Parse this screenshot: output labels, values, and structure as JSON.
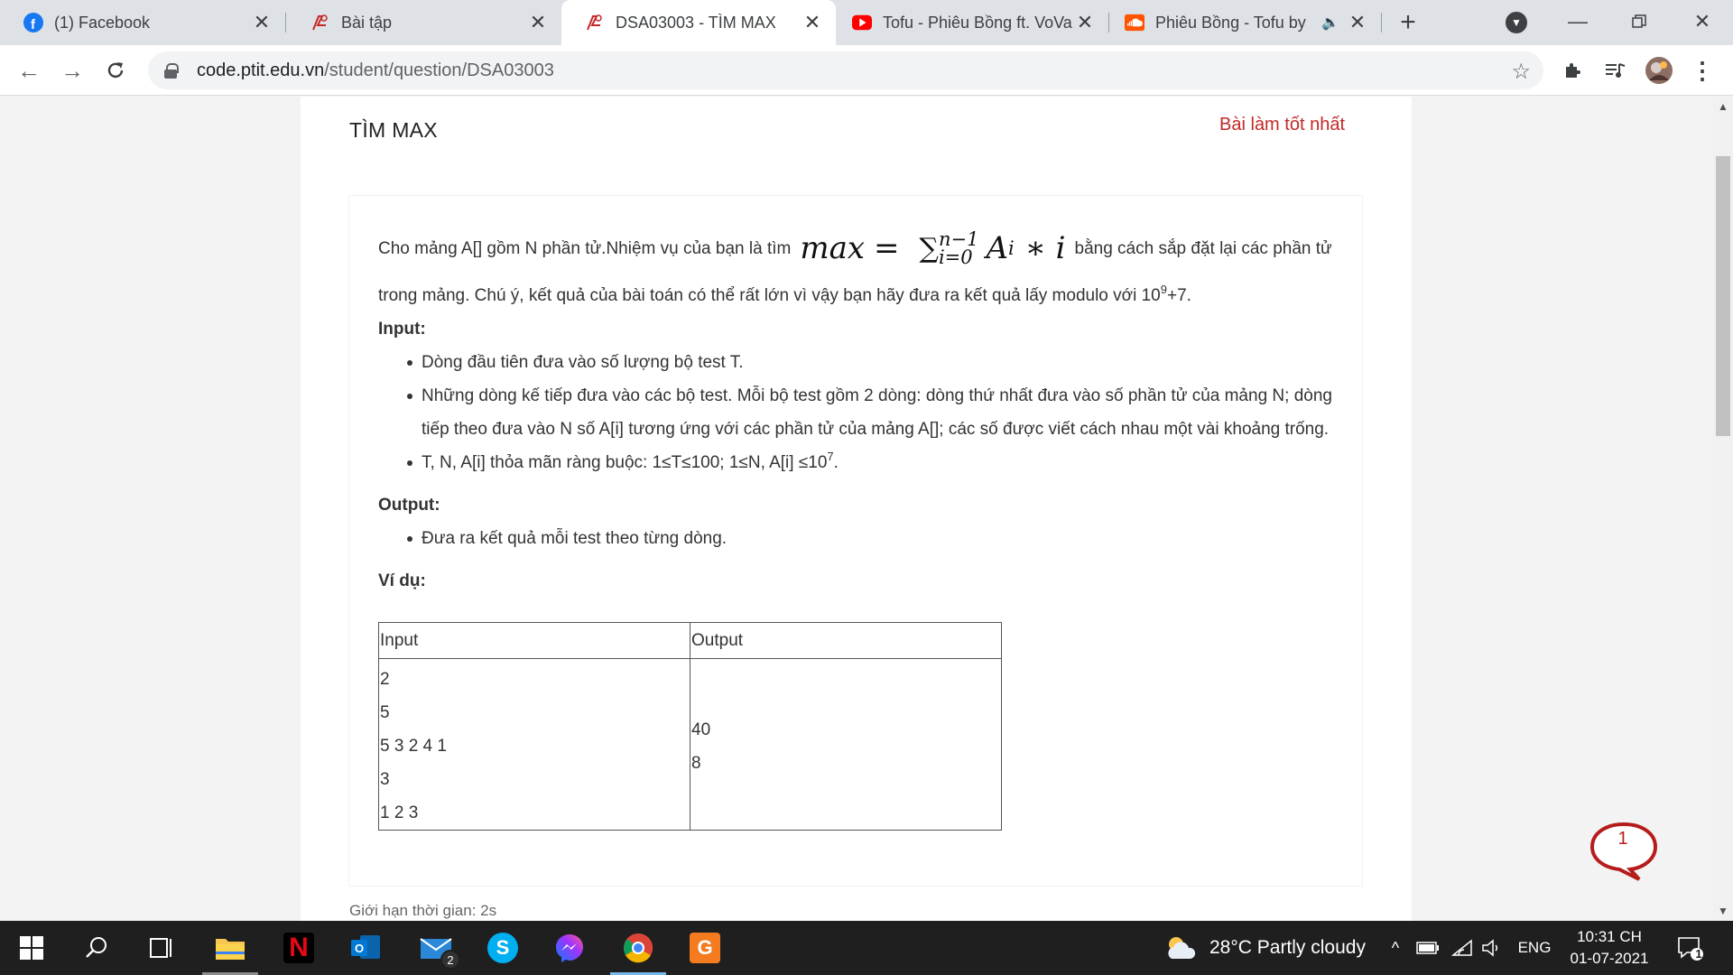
{
  "browser": {
    "tabs": [
      {
        "title": "(1) Facebook",
        "icon": "facebook-icon",
        "active": false
      },
      {
        "title": "Bài tập",
        "icon": "ptit-code-icon",
        "active": false
      },
      {
        "title": "DSA03003 - TÌM MAX",
        "icon": "ptit-code-icon",
        "active": true
      },
      {
        "title": "Tofu - Phiêu Bồng ft. VoVa",
        "icon": "youtube-icon",
        "active": false
      },
      {
        "title": "Phiêu Bồng - Tofu by",
        "icon": "soundcloud-icon",
        "active": false,
        "audio": true
      }
    ],
    "url_host": "code.ptit.edu.vn",
    "url_path": "/student/question/DSA03003"
  },
  "page": {
    "title": "TÌM MAX",
    "best_link": "Bài làm tốt nhất",
    "intro_before": "Cho mảng A[] gồm N phần tử.Nhiệm vụ của bạn là tìm",
    "formula": {
      "lhs": "max",
      "eq": "=",
      "sigma": "∑",
      "upper": "n−1",
      "lower": "i=0",
      "term": "A",
      "sub": "i",
      "rest": "∗ i"
    },
    "intro_after": "bằng cách sắp đặt lại các phần tử",
    "intro_line2": "trong mảng. Chú ý, kết quả của bài toán có thể rất lớn vì vậy bạn hãy đưa ra kết quả lấy modulo với 10",
    "mod_exp": "9",
    "mod_tail": "+7.",
    "input_heading": "Input:",
    "input_items": [
      "Dòng đầu tiên đưa vào số lượng bộ test T.",
      "Những dòng kế tiếp đưa vào các bộ test. Mỗi bộ test gồm 2 dòng: dòng thứ nhất đưa vào số phần tử của mảng N; dòng tiếp theo đưa vào N số A[i] tương ứng với các phần tử của mảng A[]; các số được viết cách nhau một vài khoảng trống."
    ],
    "constraint_text": "T, N, A[i] thỏa mãn ràng buộc: 1≤T≤100;  1≤N, A[i] ≤10",
    "constraint_exp": "7",
    "constraint_tail": ".",
    "output_heading": "Output:",
    "output_items": [
      "Đưa ra kết quả mỗi test theo từng dòng."
    ],
    "example_heading": "Ví dụ:",
    "example": {
      "headers": [
        "Input",
        "Output"
      ],
      "input_lines": [
        "2",
        "5",
        "5 3 2 4 1",
        "3",
        "1 2 3"
      ],
      "output_lines": [
        "40",
        "8"
      ]
    },
    "time_limit": "Giới hạn thời gian: 2s",
    "chat_count": "1"
  },
  "taskbar": {
    "weather": "28°C  Partly cloudy",
    "lang": "ENG",
    "time": "10:31 CH",
    "date": "01-07-2021",
    "mail_badge": "2",
    "notif_badge": "1"
  }
}
